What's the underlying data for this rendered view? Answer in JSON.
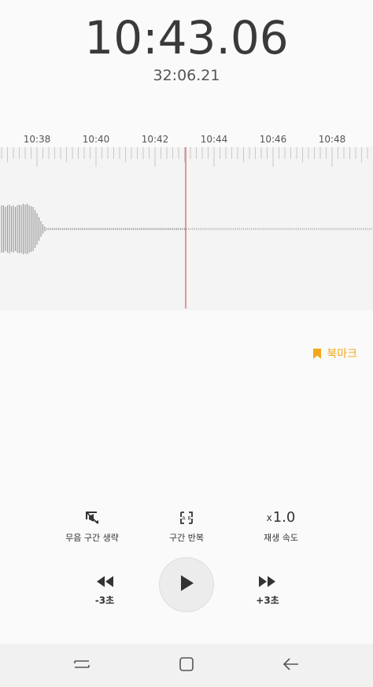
{
  "recording": {
    "current_time": "10:43.06",
    "total_time": "32:06.21"
  },
  "timeline": {
    "tick_labels": [
      "10:38",
      "10:40",
      "10:42",
      "10:44",
      "10:46",
      "10:48"
    ],
    "playhead_color": "#e57373"
  },
  "bookmark": {
    "label": "북마크",
    "color": "#f2a81d"
  },
  "controls": {
    "skip_silence": "무음 구간 생략",
    "repeat": "구간 반복",
    "speed_value": "1.0",
    "speed_prefix": "x",
    "speed_label": "재생 속도"
  },
  "playback": {
    "rewind_label": "-3초",
    "forward_label": "+3초"
  },
  "icons": {
    "skip_silence": "mute-skip-icon",
    "repeat": "ab-repeat-icon",
    "rewind": "rewind-icon",
    "play": "play-icon",
    "forward": "fast-forward-icon",
    "bookmark": "bookmark-icon"
  }
}
